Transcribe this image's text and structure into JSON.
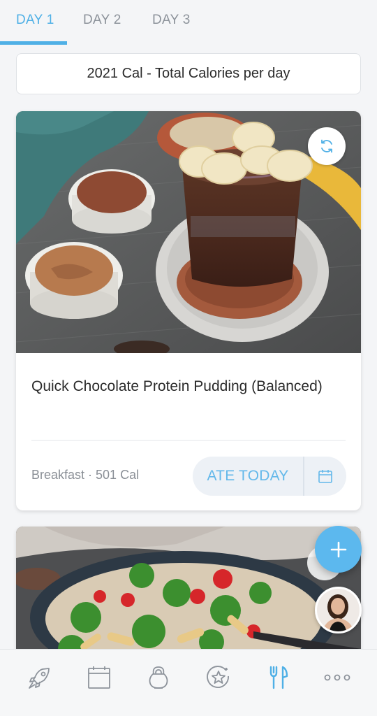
{
  "tabs": [
    {
      "label": "DAY 1",
      "active": true
    },
    {
      "label": "DAY 2",
      "active": false
    },
    {
      "label": "DAY 3",
      "active": false
    }
  ],
  "calorie_banner": "2021 Cal - Total Calories per day",
  "meals": [
    {
      "title": "Quick Chocolate Protein Pudding (Balanced)",
      "meta": "Breakfast · 501 Cal",
      "ate_label": "ATE TODAY",
      "image": "chocolate-pudding-photo"
    },
    {
      "image": "pasta-salad-photo"
    }
  ],
  "icons": {
    "swap": "refresh-icon",
    "calendar": "calendar-icon",
    "fab": "plus-icon",
    "avatar": "trainer-avatar"
  },
  "bottom_nav": [
    {
      "icon": "rocket-icon"
    },
    {
      "icon": "calendar-icon"
    },
    {
      "icon": "kettlebell-icon"
    },
    {
      "icon": "star-badge-icon"
    },
    {
      "icon": "fork-knife-icon",
      "active": true
    },
    {
      "icon": "more-icon"
    }
  ],
  "colors": {
    "accent": "#4fb0e6",
    "fab": "#5cb8ee",
    "inactive": "#8d939b"
  }
}
